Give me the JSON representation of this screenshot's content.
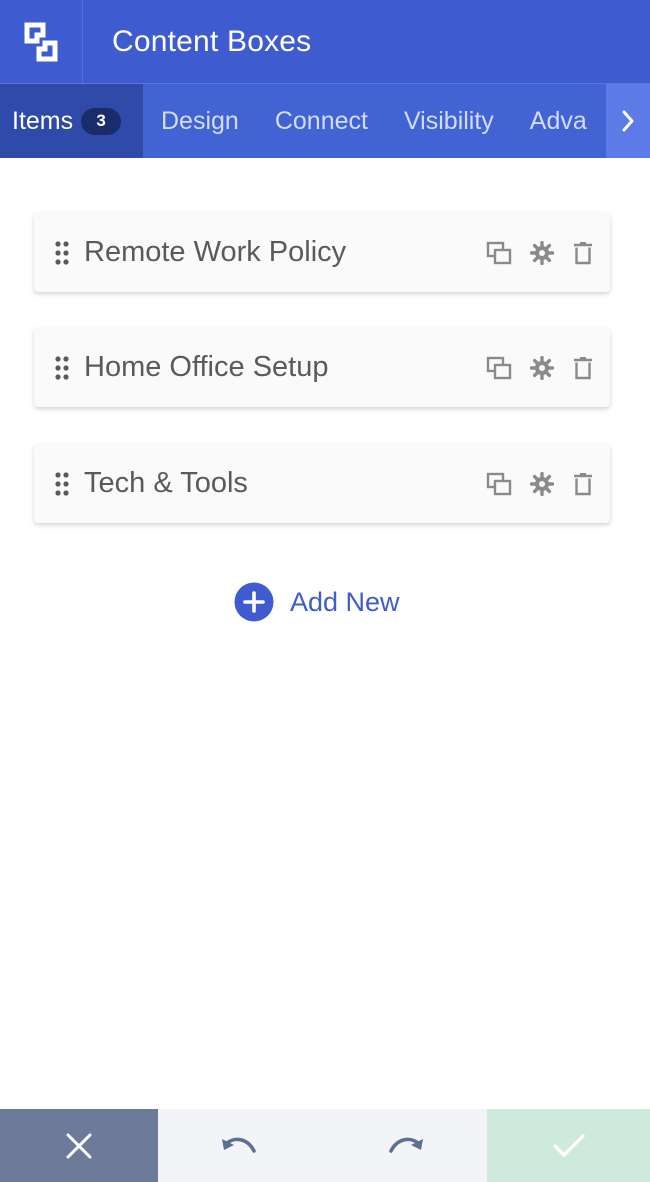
{
  "header": {
    "title": "Content Boxes",
    "logo_icon": "builder-logo-icon"
  },
  "tabs": [
    {
      "label": "Items",
      "badge": "3",
      "active": true
    },
    {
      "label": "Design"
    },
    {
      "label": "Connect"
    },
    {
      "label": "Visibility"
    },
    {
      "label": "Adva"
    }
  ],
  "items": [
    {
      "label": "Remote Work Policy"
    },
    {
      "label": "Home Office Setup"
    },
    {
      "label": "Tech & Tools"
    }
  ],
  "add_new": {
    "label": "Add New"
  },
  "colors": {
    "accent": "#3e5ccf",
    "tab_active": "#2f4aa9",
    "cancel": "#6e7a99",
    "save": "#cdeadc"
  }
}
